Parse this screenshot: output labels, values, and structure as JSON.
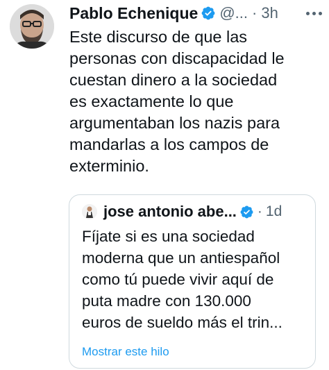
{
  "tweet": {
    "author_name": "Pablo Echenique",
    "author_handle": "@...",
    "separator": "·",
    "time": "3h",
    "text": "Este discurso de que las\npersonas con discapacidad le\ncuestan dinero a la sociedad\nes exactamente lo que\nargumentaban los nazis para\nmandarlas a los campos de\nexterminio."
  },
  "quoted_tweet": {
    "author_name": "jose antonio abe...",
    "separator": "·",
    "time": "1d",
    "text": "Fíjate si es una sociedad\nmoderna que un antiespañol\ncomo tú puede vivir aquí de\nputa madre con 130.000\neuros de sueldo más el trin...",
    "show_thread_label": "Mostrar este hilo"
  },
  "colors": {
    "verified": "#1d9bf0",
    "link": "#1d9bf0",
    "secondary_text": "#536471",
    "border": "#cfd9de"
  },
  "icons": {
    "verified": "verified-badge-icon",
    "more": "more-options-icon"
  }
}
